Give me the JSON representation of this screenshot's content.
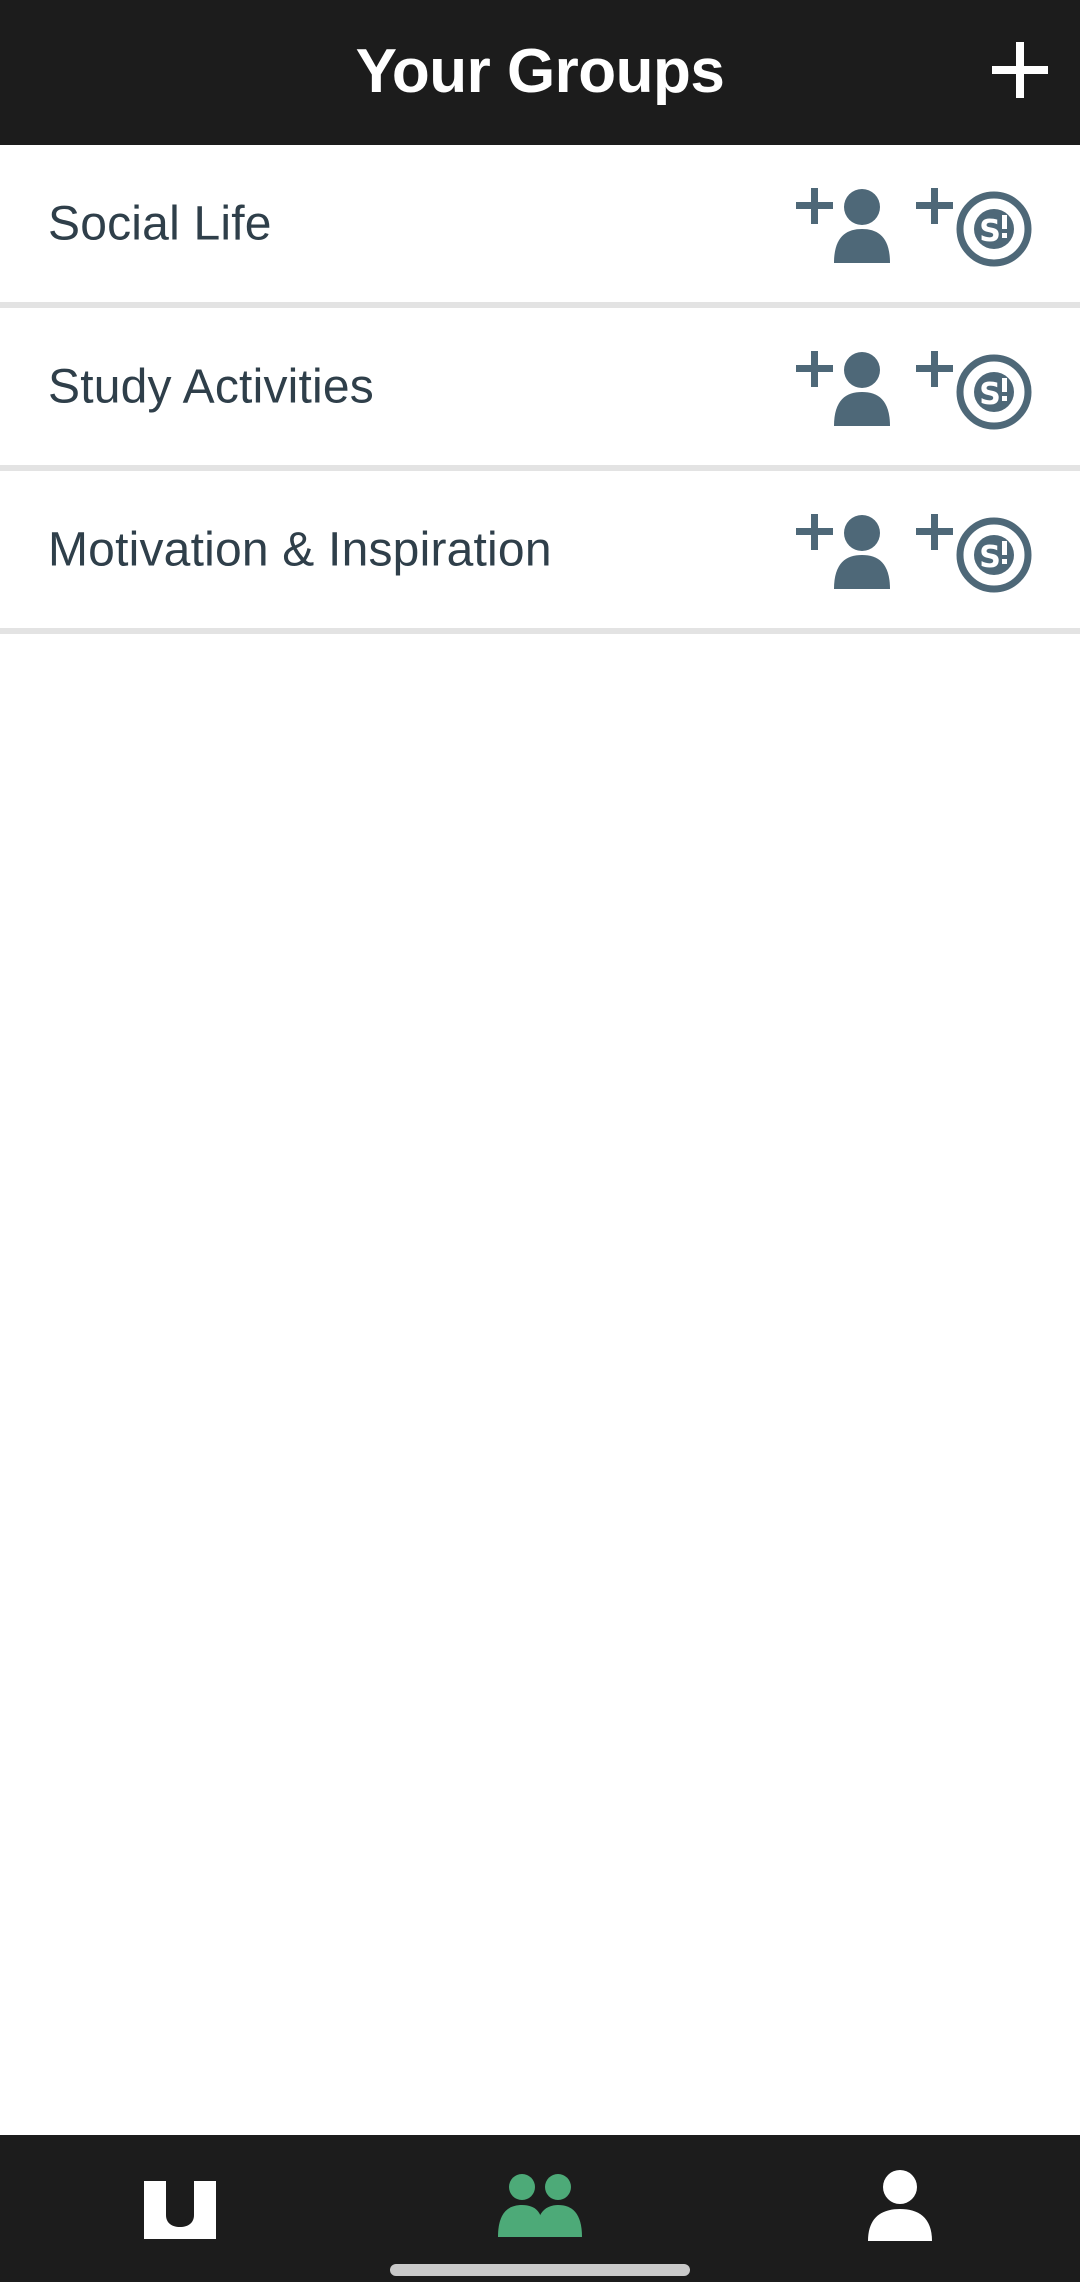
{
  "header": {
    "title": "Your Groups",
    "add_icon": "plus-icon"
  },
  "groups": [
    {
      "name": "Social Life",
      "actions": [
        "add-person-icon",
        "add-money-icon"
      ]
    },
    {
      "name": "Study Activities",
      "actions": [
        "add-person-icon",
        "add-money-icon"
      ]
    },
    {
      "name": "Motivation & Inspiration",
      "actions": [
        "add-person-icon",
        "add-money-icon"
      ]
    }
  ],
  "tabbar": {
    "tabs": [
      {
        "id": "home",
        "icon": "u-logo-icon",
        "active": false
      },
      {
        "id": "groups",
        "icon": "groups-icon",
        "active": true
      },
      {
        "id": "profile",
        "icon": "person-icon",
        "active": false
      }
    ]
  },
  "colors": {
    "header_bg": "#1c1c1c",
    "text_primary": "#2f3f4a",
    "icon_slate": "#4e6878",
    "active_tab": "#4daa78",
    "divider": "#e3e3e3"
  }
}
